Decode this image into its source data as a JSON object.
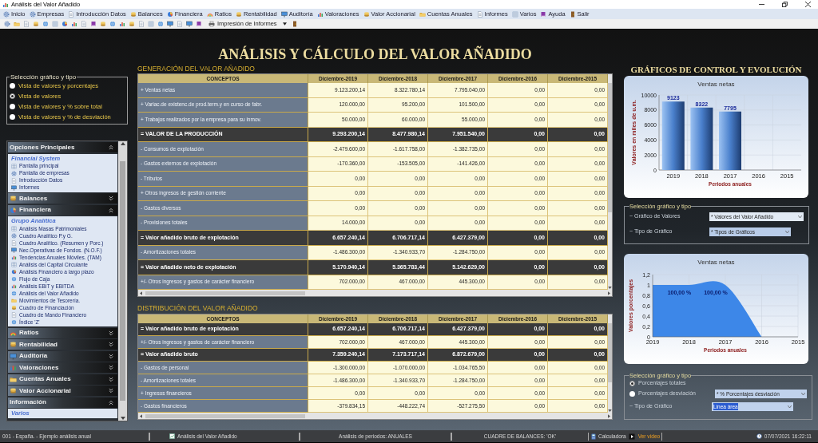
{
  "window": {
    "title": "Análisis del Valor Añadido"
  },
  "menu": [
    "Inicio",
    "Empresas",
    "Introducción Datos",
    "Balances",
    "Financiera",
    "Ratios",
    "Rentabilidad",
    "Auditoría",
    "Valoraciones",
    "Valor Accionarial",
    "Cuentas Anuales",
    "Informes",
    "Varios",
    "Ayuda",
    "Salir"
  ],
  "toolbar": {
    "print_menu": "Impresión de Informes"
  },
  "page_title": "ANÁLISIS Y CÁLCULO DEL VALOR AÑADIDO",
  "view_options": {
    "title": "Selección gráfico y tipo",
    "options": [
      {
        "label": "Vista de valores y porcentajes",
        "selected": false
      },
      {
        "label": "Vista de valores",
        "selected": true
      },
      {
        "label": "Vista de valores y % sobre total",
        "selected": false
      },
      {
        "label": "Vista de valores y % de desviación",
        "selected": false
      }
    ]
  },
  "sidebar": {
    "sections": [
      {
        "title": "Opciones Principales",
        "expanded": true,
        "group": "Financial System",
        "items": [
          "Pantalla principal",
          "Pantalla de empresas",
          "Introducción Datos",
          "Informes"
        ]
      },
      {
        "title": "Balances",
        "expanded": false
      },
      {
        "title": "Financiera",
        "expanded": true,
        "group": "Grupo Analítica",
        "items": [
          "Análisis Masas Patrimoniales",
          "Cuadro Analítico P.y G.",
          "Cuadro Analítico. (Resumen y Porc.)",
          "Nec.Operativas de Fondos. (N.O.F.)",
          "Tendencias Anuales Móviles. (TAM)",
          "Análisis del Capital Circulante",
          "Análisis Financiero a largo plazo",
          "Flujo de Caja",
          "Análisis EBIT y EBITDA",
          "Análisis del Valor Añadido",
          "Movimientos de Tesorería.",
          "Cuadro de Financiación",
          "Cuadro de Mando Financiero",
          "Índice 'Z'"
        ]
      },
      {
        "title": "Ratios",
        "expanded": false
      },
      {
        "title": "Rentabilidad",
        "expanded": false
      },
      {
        "title": "Auditoría",
        "expanded": false
      },
      {
        "title": "Valoraciones",
        "expanded": false
      },
      {
        "title": "Cuentas Anuales",
        "expanded": false
      },
      {
        "title": "Valor Accionarial",
        "expanded": false
      },
      {
        "title": "Información",
        "expanded": true,
        "group": "Varios"
      }
    ]
  },
  "tables": [
    {
      "title": "GENERACIÓN DEL VALOR AÑADIDO",
      "columns": [
        "CONCEPTOS",
        "Diciembre-2019",
        "Diciembre-2018",
        "Diciembre-2017",
        "Diciembre-2016",
        "Diciembre-2015"
      ],
      "rows": [
        {
          "kind": "item",
          "cells": [
            "+ Ventas netas",
            "9.123.200,14",
            "8.322.780,14",
            "7.795.040,00",
            "0,00",
            "0,00"
          ]
        },
        {
          "kind": "item",
          "cells": [
            "+ Variac.de existenc.de prod.term.y en curso de fabr.",
            "120.000,00",
            "95.200,00",
            "101.500,00",
            "0,00",
            "0,00"
          ]
        },
        {
          "kind": "item",
          "cells": [
            "+ Trabajos realizados por la empresa para su inmov.",
            "50.000,00",
            "60.000,00",
            "55.000,00",
            "0,00",
            "0,00"
          ]
        },
        {
          "kind": "total",
          "cells": [
            "= VALOR DE LA PRODUCCIÓN",
            "9.293.200,14",
            "8.477.980,14",
            "7.951.540,00",
            "0,00",
            "0,00"
          ]
        },
        {
          "kind": "item",
          "cells": [
            "- Consumos de explotación",
            "-2.479.600,00",
            "-1.617.758,00",
            "-1.382.735,00",
            "0,00",
            "0,00"
          ]
        },
        {
          "kind": "item",
          "cells": [
            "- Gastos externos de explotación",
            "-170.360,00",
            "-153.505,00",
            "-141.426,00",
            "0,00",
            "0,00"
          ]
        },
        {
          "kind": "item",
          "cells": [
            "- Tributos",
            "0,00",
            "0,00",
            "0,00",
            "0,00",
            "0,00"
          ]
        },
        {
          "kind": "item",
          "cells": [
            "+ Otros ingresos de gestión corriente",
            "0,00",
            "0,00",
            "0,00",
            "0,00",
            "0,00"
          ]
        },
        {
          "kind": "item",
          "cells": [
            "- Gastos diversos",
            "0,00",
            "0,00",
            "0,00",
            "0,00",
            "0,00"
          ]
        },
        {
          "kind": "item",
          "cells": [
            "- Provisiones totales",
            "14.000,00",
            "0,00",
            "0,00",
            "0,00",
            "0,00"
          ]
        },
        {
          "kind": "total",
          "cells": [
            "= Valor añadido bruto de explotación",
            "6.657.240,14",
            "6.706.717,14",
            "6.427.379,00",
            "0,00",
            "0,00"
          ]
        },
        {
          "kind": "item",
          "cells": [
            "- Amortizaciones totales",
            "-1.486.300,00",
            "-1.340.933,70",
            "-1.284.750,00",
            "0,00",
            "0,00"
          ]
        },
        {
          "kind": "total",
          "cells": [
            "= Valor añadido neto de explotación",
            "5.170.940,14",
            "5.365.783,44",
            "5.142.629,00",
            "0,00",
            "0,00"
          ]
        },
        {
          "kind": "item",
          "cells": [
            "+/- Otros ingresos y gastos de carácter financiero",
            "702.000,00",
            "467.000,00",
            "445.300,00",
            "0,00",
            "0,00"
          ]
        }
      ]
    },
    {
      "title": "DISTRIBUCIÓN DEL VALOR AÑADIDO",
      "columns": [
        "CONCEPTOS",
        "Diciembre-2019",
        "Diciembre-2018",
        "Diciembre-2017",
        "Diciembre-2016",
        "Diciembre-2015"
      ],
      "rows": [
        {
          "kind": "total",
          "cells": [
            "= Valor añadido bruto de explotación",
            "6.657.240,14",
            "6.706.717,14",
            "6.427.379,00",
            "0,00",
            "0,00"
          ]
        },
        {
          "kind": "item",
          "cells": [
            "+/- Otros ingresos y gastos de carácter financiero",
            "702.000,00",
            "467.000,00",
            "445.300,00",
            "0,00",
            "0,00"
          ]
        },
        {
          "kind": "total",
          "cells": [
            "= Valor añadido bruto",
            "7.359.240,14",
            "7.173.717,14",
            "6.872.679,00",
            "0,00",
            "0,00"
          ]
        },
        {
          "kind": "item",
          "cells": [
            "- Gastos de personal",
            "-1.300.000,00",
            "-1.070.000,00",
            "-1.034.765,50",
            "0,00",
            "0,00"
          ]
        },
        {
          "kind": "item",
          "cells": [
            "- Amortizaciones totales",
            "-1.486.300,00",
            "-1.340.933,70",
            "-1.284.750,00",
            "0,00",
            "0,00"
          ]
        },
        {
          "kind": "item",
          "cells": [
            "+ Ingresos financieros",
            "0,00",
            "0,00",
            "0,00",
            "0,00",
            "0,00"
          ]
        },
        {
          "kind": "item",
          "cells": [
            "- Gastos financieros",
            "-379.834,15",
            "-448.222,74",
            "-527.275,50",
            "0,00",
            "0,00"
          ]
        }
      ]
    }
  ],
  "charts_panel": {
    "title": "GRÁFICOS DE CONTROL Y EVOLUCIÓN",
    "value_chart": {
      "chart_data": {
        "type": "bar",
        "title": "Ventas netas",
        "xlabel": "Periodos anuales",
        "ylabel": "Valores en miles de u.m.",
        "categories": [
          "2019",
          "2018",
          "2017",
          "2016",
          "2015"
        ],
        "values": [
          9123,
          8322,
          7795,
          0,
          0
        ],
        "ylim": [
          0,
          10000
        ],
        "yticks": [
          0,
          2000,
          4000,
          6000,
          8000,
          10000
        ],
        "grid": true,
        "value_labels": [
          "9123",
          "8322",
          "7795",
          null,
          null
        ]
      }
    },
    "value_selector": {
      "title": "Selección gráfico y tipo",
      "fields": [
        {
          "label": "~ Gráfico de Valores",
          "value": "* Valores del Valor Añadido"
        },
        {
          "label": "~ Tipo de Gráfico",
          "value": "* Tipos de Gráficos"
        }
      ]
    },
    "percent_chart": {
      "chart_data": {
        "type": "area",
        "title": "Ventas netas",
        "xlabel": "Periodos anuales",
        "ylabel": "Valores porcentajes",
        "categories": [
          "2019",
          "2018",
          "2017",
          "2016",
          "2015"
        ],
        "values": [
          1,
          1,
          1,
          0,
          null
        ],
        "ylim": [
          0,
          1.2
        ],
        "yticks": [
          {
            "value": 0,
            "label": "0"
          },
          {
            "value": 0.2,
            "label": "0,2"
          },
          {
            "value": 0.4,
            "label": "0,4"
          },
          {
            "value": 0.6,
            "label": "0,6"
          },
          {
            "value": 0.8,
            "label": "0,8"
          },
          {
            "value": 1,
            "label": "1"
          },
          {
            "value": 1.2,
            "label": "1,2"
          }
        ],
        "grid": true,
        "value_labels": [
          null,
          "100,00 %",
          "100,00 %",
          null,
          null
        ]
      }
    },
    "percent_selector": {
      "title": "Selección gráfico y tipo",
      "options": [
        {
          "label": "Porcentajes totales",
          "selected": true
        },
        {
          "label": "Porcentajes desviación",
          "selected": false
        }
      ],
      "mode_field": {
        "value": "* % Porcentajes desviación"
      },
      "type_field": {
        "label": "~ Tipo de Gráfico",
        "value": "Linea área",
        "highlighted": true
      }
    }
  },
  "status_bar": {
    "company": "001 - España. - Ejemplo análisis anual",
    "module": "Análisis del Valor Añadido",
    "periods": "Análisis de periodos: ANUALES",
    "balance_check": "CUADRE DE BALANCES: 'OK'",
    "calculator": "Calculadora",
    "video_link": "Ver vídeo",
    "datetime": "07/07/2021 16:22:11"
  }
}
